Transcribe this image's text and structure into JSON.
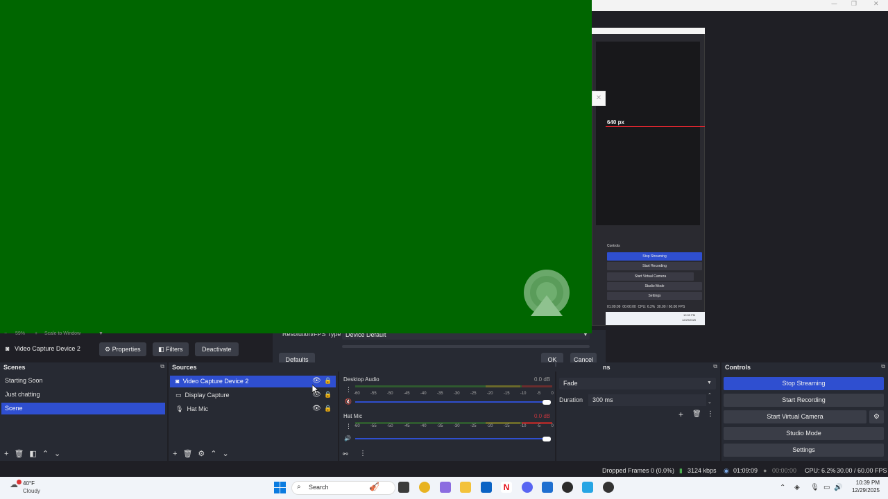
{
  "preview": {
    "scale_zoom": "59%",
    "scale_mode": "Scale to Window"
  },
  "nested_preview": {
    "size_label": "640 px",
    "controls_title": "Controls",
    "buttons": [
      "Stop Streaming",
      "Start Recording",
      "Start Virtual Camera",
      "Studio Mode",
      "Settings"
    ],
    "status_time": "01:09:09",
    "status_rec": "00:00:00",
    "status_cpu": "CPU: 6.2%",
    "status_fps": "30.00 / 60.00 FPS",
    "clock": "10:39 PM",
    "date": "12/29/2025"
  },
  "dialog": {
    "res_label": "Resolution/FPS Type",
    "res_value": "Device Default",
    "defaults_label": "Defaults",
    "ok_label": "OK",
    "cancel_label": "Cancel"
  },
  "source_toolbar": {
    "source_name": "Video Capture Device 2",
    "properties": "Properties",
    "filters": "Filters",
    "deactivate": "Deactivate"
  },
  "scenes": {
    "title": "Scenes",
    "items": [
      "Starting Soon",
      "Just chatting",
      "Scene"
    ],
    "selected": "Scene"
  },
  "sources": {
    "title": "Sources",
    "items": [
      "Video Capture Device 2",
      "Display Capture",
      "Hat Mic"
    ]
  },
  "mixer": {
    "channels": [
      {
        "name": "Desktop Audio",
        "db": "0.0 dB"
      },
      {
        "name": "Hat Mic",
        "db": "0.0 dB"
      }
    ],
    "ticks": [
      "-60",
      "-55",
      "-50",
      "-45",
      "-40",
      "-35",
      "-30",
      "-25",
      "-20",
      "-15",
      "-10",
      "-5",
      "0"
    ]
  },
  "transitions": {
    "title": "ns",
    "type": "Fade",
    "duration_label": "Duration",
    "duration_value": "300 ms"
  },
  "controls": {
    "title": "Controls",
    "stop_streaming": "Stop Streaming",
    "start_recording": "Start Recording",
    "start_virtual_camera": "Start Virtual Camera",
    "studio_mode": "Studio Mode",
    "settings": "Settings"
  },
  "status": {
    "dropped_frames": "Dropped Frames 0 (0.0%)",
    "bitrate": "3124 kbps",
    "stream_time": "01:09:09",
    "rec_time": "00:00:00",
    "cpu": "CPU: 6.2%",
    "fps": "30.00 / 60.00 FPS"
  },
  "taskbar": {
    "weather_temp": "40°F",
    "weather_desc": "Cloudy",
    "search": "Search",
    "clock": "10:39 PM",
    "date": "12/29/2025"
  }
}
